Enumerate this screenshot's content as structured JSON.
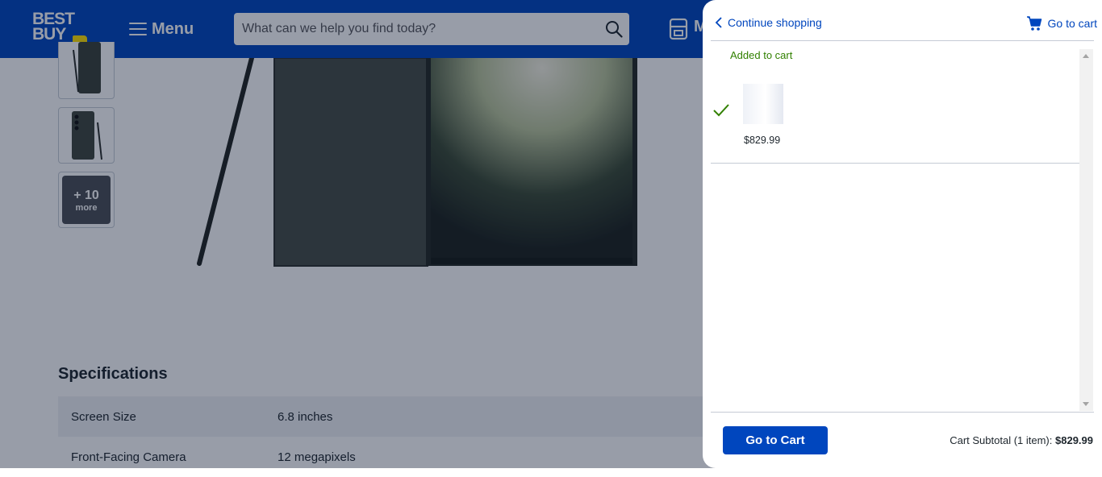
{
  "header": {
    "logo": {
      "line1": "BEST",
      "line2": "BUY"
    },
    "menu_label": "Menu",
    "search": {
      "placeholder": "What can we help you find today?",
      "value": ""
    },
    "store_label": "M",
    "colors": {
      "brand_blue": "#0046be",
      "tag_yellow": "#ffe000"
    }
  },
  "gallery": {
    "more_count": "+ 10",
    "more_label": "more"
  },
  "specifications": {
    "title": "Specifications",
    "rows": [
      {
        "name": "Screen Size",
        "value": "6.8 inches"
      },
      {
        "name": "Front-Facing Camera",
        "value": "12 megapixels"
      }
    ]
  },
  "drawer": {
    "continue_label": "Continue shopping",
    "goto_cart_link": "Go to cart",
    "added_label": "Added to cart",
    "item": {
      "price": "$829.99"
    },
    "goto_cart_button": "Go to Cart",
    "subtotal": {
      "label": "Cart Subtotal (1 item):",
      "amount": "$829.99"
    },
    "colors": {
      "link_blue": "#0046be",
      "success_green": "#318000"
    }
  }
}
